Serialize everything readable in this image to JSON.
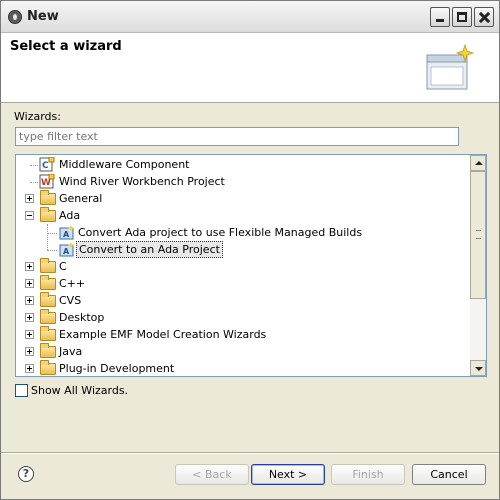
{
  "window": {
    "title": "New"
  },
  "header": {
    "title": "Select a wizard"
  },
  "wizards": {
    "label": "Wizards:",
    "filter_placeholder": "type filter text"
  },
  "tree": {
    "items": [
      {
        "label": "Middleware Component",
        "icon": "middleware-component-icon"
      },
      {
        "label": "Wind River Workbench Project",
        "icon": "wind-river-project-icon"
      },
      {
        "label": "General",
        "icon": "folder-icon",
        "expander": "plus"
      },
      {
        "label": "Ada",
        "icon": "folder-open-icon",
        "expander": "minus"
      },
      {
        "label": "Convert Ada project to use Flexible Managed Builds",
        "icon": "ada-wizard-icon"
      },
      {
        "label": "Convert to an Ada Project",
        "icon": "ada-wizard-icon",
        "selected": true
      },
      {
        "label": "C",
        "icon": "folder-icon",
        "expander": "plus"
      },
      {
        "label": "C++",
        "icon": "folder-icon",
        "expander": "plus"
      },
      {
        "label": "CVS",
        "icon": "folder-icon",
        "expander": "plus"
      },
      {
        "label": "Desktop",
        "icon": "folder-icon",
        "expander": "plus"
      },
      {
        "label": "Example EMF Model Creation Wizards",
        "icon": "folder-icon",
        "expander": "plus"
      },
      {
        "label": "Java",
        "icon": "folder-icon",
        "expander": "plus"
      },
      {
        "label": "Plug-in Development",
        "icon": "folder-icon",
        "expander": "plus"
      }
    ]
  },
  "show_all": {
    "label": "Show All Wizards.",
    "checked": false
  },
  "buttons": {
    "back": "< Back",
    "next": "Next >",
    "finish": "Finish",
    "cancel": "Cancel"
  },
  "help": {
    "glyph": "?"
  }
}
